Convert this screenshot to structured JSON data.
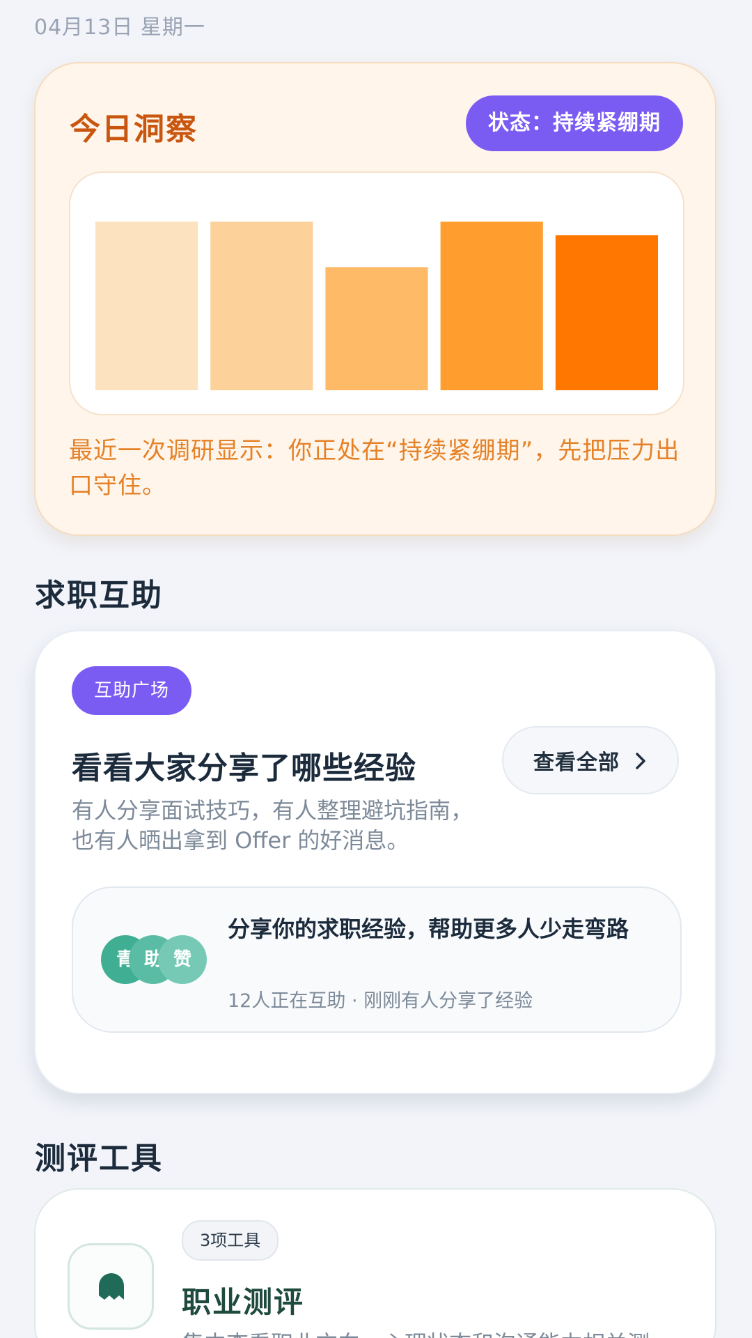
{
  "header": {
    "date": "04月13日 星期一"
  },
  "insight": {
    "title": "今日洞察",
    "status": "状态：持续紧绷期",
    "description": "最近一次调研显示：你正处在“持续紧绷期”，先把压力出口守住。"
  },
  "chart_data": {
    "type": "bar",
    "values": [
      100,
      100,
      73,
      100,
      92
    ],
    "ylim": [
      0,
      100
    ],
    "colors": [
      "#fde2c0",
      "#fdd19a",
      "#feba66",
      "#ff9d2e",
      "#ff7700"
    ],
    "grid": false,
    "title": "",
    "xlabel": "",
    "ylabel": ""
  },
  "help_section": {
    "title": "求职互助",
    "badge": "互助广场",
    "heading": "看看大家分享了哪些经验",
    "description": "有人分享面试技巧，有人整理避坑指南，也有人晒出拿到 Offer 的好消息。",
    "view_all": "查看全部",
    "share": {
      "avatars": [
        "青",
        "助",
        "赞"
      ],
      "title": "分享你的求职经验，帮助更多人少走弯路",
      "meta": "12人正在互助 · 刚刚有人分享了经验"
    }
  },
  "tools_section": {
    "title": "测评工具",
    "badge": "3项工具",
    "card_title": "职业测评",
    "description": "集中查看职业方向、心理状态和沟通能力相关测",
    "icon": "ghost-icon",
    "icon_color": "#1f6b58"
  }
}
